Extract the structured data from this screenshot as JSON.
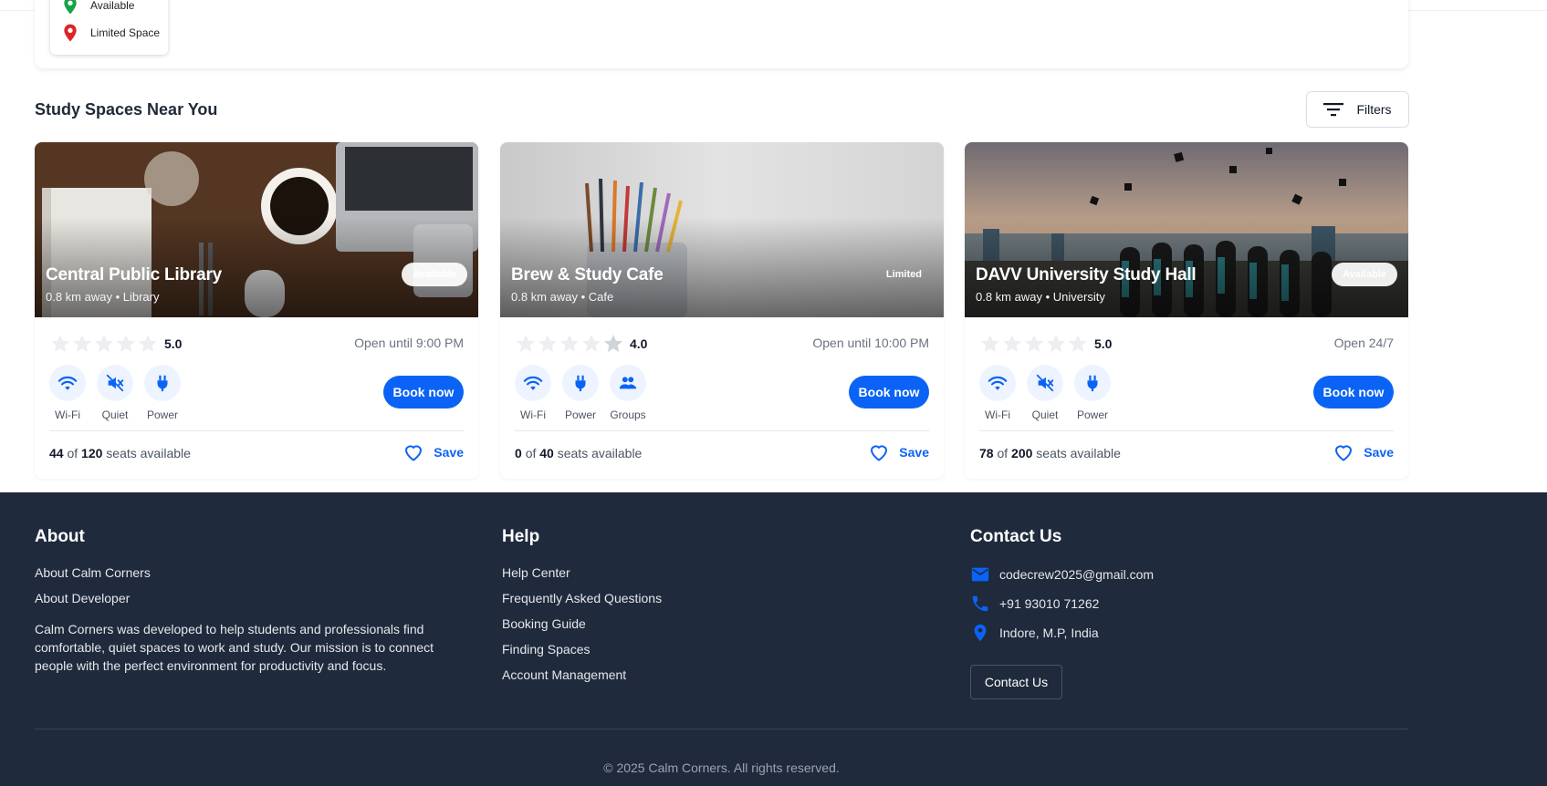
{
  "legend": {
    "items": [
      {
        "label": "Available",
        "color": "#16a34a"
      },
      {
        "label": "Limited Space",
        "color": "#dc2626"
      }
    ]
  },
  "section": {
    "title": "Study Spaces Near You",
    "filters_label": "Filters"
  },
  "cards": [
    {
      "name": "Central Public Library",
      "subtitle": "0.8 km away • Library",
      "badge": "Available",
      "rating": "5.0",
      "hours": "Open until 9:00 PM",
      "amenities": [
        "Wi-Fi",
        "Quiet",
        "Power"
      ],
      "book_label": "Book now",
      "seats_available": "44",
      "seats_of": "of",
      "seats_total": "120",
      "seats_suffix": "seats available",
      "save_label": "Save"
    },
    {
      "name": "Brew & Study Cafe",
      "subtitle": "0.8 km away • Cafe",
      "badge": "Limited",
      "rating": "4.0",
      "hours": "Open until 10:00 PM",
      "amenities": [
        "Wi-Fi",
        "Power",
        "Groups"
      ],
      "book_label": "Book now",
      "seats_available": "0",
      "seats_of": "of",
      "seats_total": "40",
      "seats_suffix": "seats available",
      "save_label": "Save"
    },
    {
      "name": "DAVV University Study Hall",
      "subtitle": "0.8 km away • University",
      "badge": "Available",
      "rating": "5.0",
      "hours": "Open 24/7",
      "amenities": [
        "Wi-Fi",
        "Quiet",
        "Power"
      ],
      "book_label": "Book now",
      "seats_available": "78",
      "seats_of": "of",
      "seats_total": "200",
      "seats_suffix": "seats available",
      "save_label": "Save"
    }
  ],
  "footer": {
    "about": {
      "title": "About",
      "links": [
        "About Calm Corners",
        "About Developer"
      ],
      "description": "Calm Corners was developed to help students and professionals find comfortable, quiet spaces to work and study. Our mission is to connect people with the perfect environment for productivity and focus."
    },
    "help": {
      "title": "Help",
      "links": [
        "Help Center",
        "Frequently Asked Questions",
        "Booking Guide",
        "Finding Spaces",
        "Account Management"
      ]
    },
    "contact": {
      "title": "Contact Us",
      "email": "codecrew2025@gmail.com",
      "phone": "+91 93010 71262",
      "location": "Indore, M.P, India",
      "button_label": "Contact Us"
    },
    "copyright": "© 2025 Calm Corners. All rights reserved."
  },
  "colors": {
    "accent": "#0b63f6",
    "footer_bg": "#1f2a3c",
    "available": "#16a34a",
    "limited": "#dc2626"
  }
}
